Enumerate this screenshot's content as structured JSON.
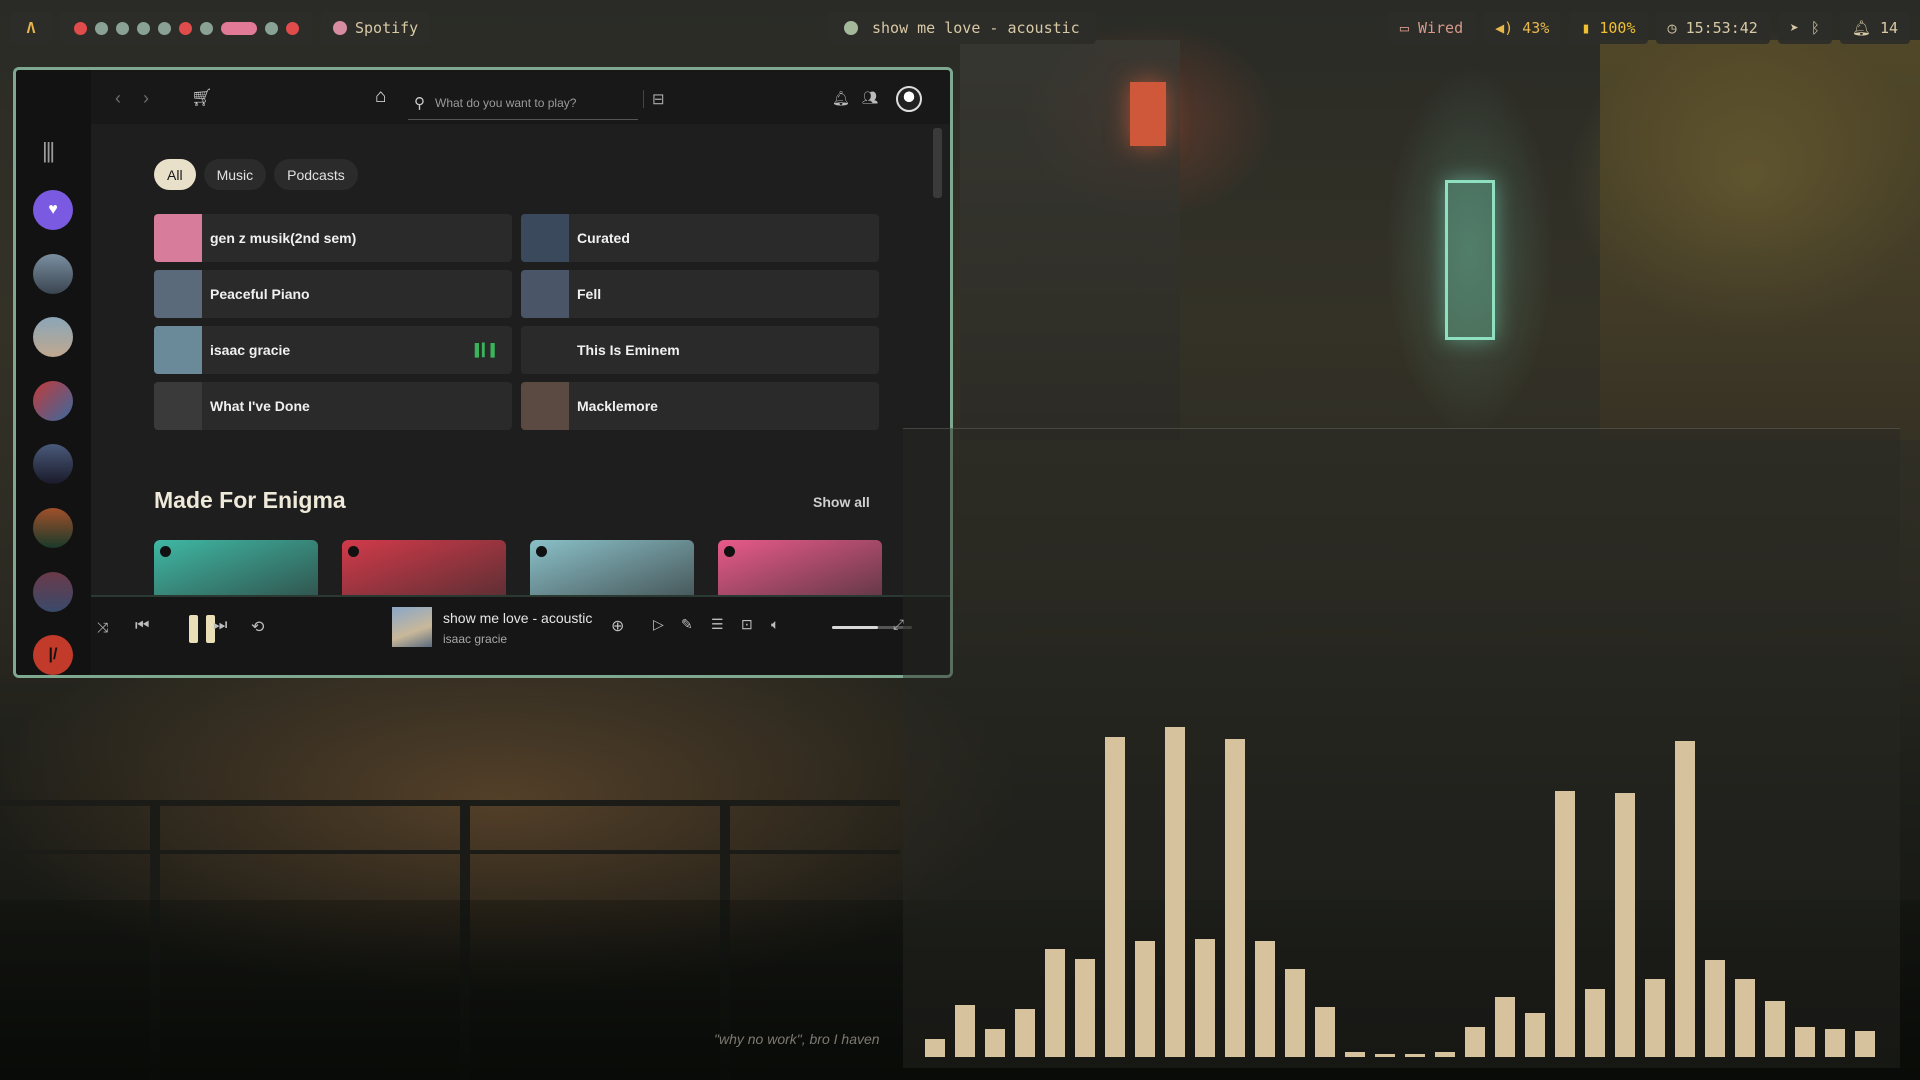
{
  "topbar": {
    "logo": "Λ",
    "workspaces": [
      "red",
      "grey",
      "grey",
      "grey",
      "grey",
      "red",
      "grey",
      "wide",
      "grey",
      "red"
    ],
    "app_label": "Spotify",
    "now_playing": "show me love - acoustic",
    "network": "Wired",
    "volume": "43%",
    "battery": "100%",
    "clock": "15:53:42",
    "notifications": "14"
  },
  "spotify": {
    "search_placeholder": "What do you want to play?",
    "chips": [
      "All",
      "Music",
      "Podcasts"
    ],
    "shortcuts": [
      {
        "label": "gen z musik(2nd sem)",
        "color": "#d77c9a"
      },
      {
        "label": "Curated",
        "color": "#3a4a5c"
      },
      {
        "label": "Peaceful Piano",
        "color": "#5a6a7a"
      },
      {
        "label": "Fell",
        "color": "#4a5568"
      },
      {
        "label": "isaac gracie",
        "color": "#6a8a9a",
        "playing": true
      },
      {
        "label": "This Is Eminem",
        "color": "#2a2a2a"
      },
      {
        "label": "What I've Done",
        "color": "#3a3a3a"
      },
      {
        "label": "Macklemore",
        "color": "#5a4a42"
      }
    ],
    "section_title": "Made For Enigma",
    "show_all": "Show all",
    "mix_colors": [
      "#3fb8a4",
      "#d23a4a",
      "#8ac0c8",
      "#e85a8a"
    ],
    "player": {
      "title": "show me love - acoustic",
      "artist": "isaac gracie",
      "volume_level": 0.58
    }
  },
  "visualizer": {
    "bars": [
      18,
      52,
      28,
      48,
      108,
      98,
      320,
      116,
      330,
      118,
      318,
      116,
      88,
      50,
      5,
      3,
      3,
      5,
      30,
      60,
      44,
      266,
      68,
      264,
      78,
      316,
      97,
      78,
      56,
      30,
      28,
      26
    ]
  },
  "caption": "\"why no work\", bro I haven"
}
